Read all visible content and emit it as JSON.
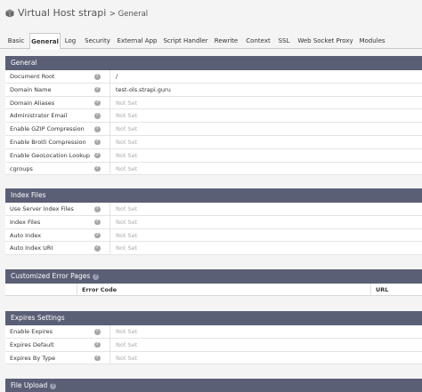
{
  "header": {
    "title": "Virtual Host strapi",
    "crumb": "> General",
    "icon": "cube-icon"
  },
  "tabs": [
    {
      "label": "Basic",
      "active": false
    },
    {
      "label": "General",
      "active": true
    },
    {
      "label": "Log",
      "active": false
    },
    {
      "label": "Security",
      "active": false
    },
    {
      "label": "External App",
      "active": false
    },
    {
      "label": "Script Handler",
      "active": false
    },
    {
      "label": "Rewrite",
      "active": false
    },
    {
      "label": "Context",
      "active": false
    },
    {
      "label": "SSL",
      "active": false
    },
    {
      "label": "Web Socket Proxy",
      "active": false
    },
    {
      "label": "Modules",
      "active": false
    }
  ],
  "general": {
    "title": "General",
    "rows": [
      {
        "label": "Document Root",
        "value": "/"
      },
      {
        "label": "Domain Name",
        "value": "test-ols.strapi.guru"
      },
      {
        "label": "Domain Aliases",
        "value": "Not Set"
      },
      {
        "label": "Administrator Email",
        "value": "Not Set"
      },
      {
        "label": "Enable GZIP Compression",
        "value": "Not Set"
      },
      {
        "label": "Enable Brotli Compression",
        "value": "Not Set"
      },
      {
        "label": "Enable GeoLocation Lookup",
        "value": "Not Set"
      },
      {
        "label": "cgroups",
        "value": "Not Set"
      }
    ]
  },
  "index_files": {
    "title": "Index Files",
    "rows": [
      {
        "label": "Use Server Index Files",
        "value": "Not Set"
      },
      {
        "label": "Index Files",
        "value": "Not Set"
      },
      {
        "label": "Auto Index",
        "value": "Not Set"
      },
      {
        "label": "Auto Index URI",
        "value": "Not Set"
      }
    ]
  },
  "error_pages": {
    "title": "Customized Error Pages",
    "col_error_code": "Error Code",
    "col_url": "URL"
  },
  "expires": {
    "title": "Expires Settings",
    "rows": [
      {
        "label": "Enable Expires",
        "value": "Not Set"
      },
      {
        "label": "Expires Default",
        "value": "Not Set"
      },
      {
        "label": "Expires By Type",
        "value": "Not Set"
      }
    ]
  },
  "file_upload": {
    "title": "File Upload"
  },
  "help_glyph": "?",
  "colors": {
    "section_header": "#5a5f75",
    "not_set": "#aaaaaa"
  }
}
